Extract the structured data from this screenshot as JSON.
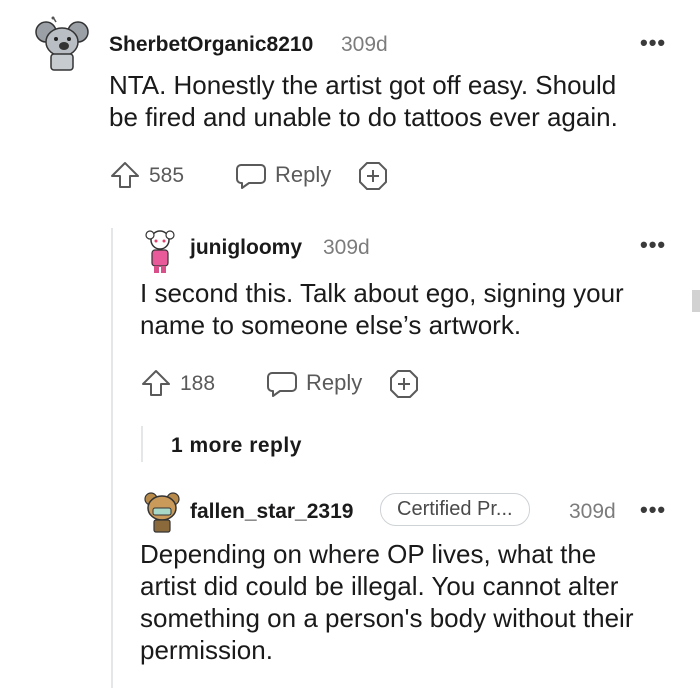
{
  "comments": [
    {
      "username": "SherbetOrganic8210",
      "age": "309d",
      "text_lines": [
        "NTA. Honestly the artist got off easy. Should",
        "be fired and unable to do tattoos ever again."
      ],
      "upvotes": "585",
      "reply_label": "Reply"
    },
    {
      "username": "junigloomy",
      "age": "309d",
      "text_lines": [
        "I second this. Talk about ego, signing your",
        "name to someone else’s artwork."
      ],
      "upvotes": "188",
      "reply_label": "Reply",
      "more_replies": "1 more reply"
    },
    {
      "username": "fallen_star_2319",
      "age": "309d",
      "flair": "Certified Pr...",
      "text_lines": [
        "Depending on where OP lives, what the",
        "artist did could be illegal. You cannot alter",
        "something on a person's body without their",
        "permission."
      ]
    }
  ],
  "icons": {
    "upvote": "arrow-up-outline",
    "reply": "speech-bubble",
    "award": "plus-in-diamond",
    "more": "ellipsis"
  },
  "colors": {
    "text": "#1a1a1b",
    "meta": "#7c7c7c",
    "thread_line": "#e4e6e8"
  }
}
